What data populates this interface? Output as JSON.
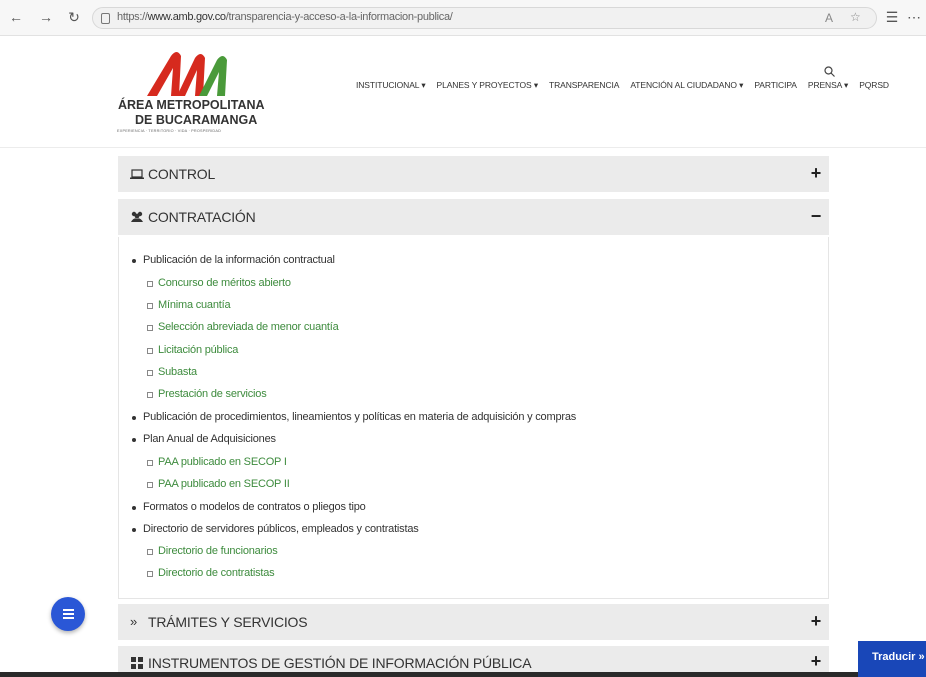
{
  "browser": {
    "url_prefix": "https://",
    "url_domain": "www.amb.gov.co",
    "url_path": "/transparencia-y-acceso-a-la-informacion-publica/"
  },
  "header": {
    "logo_title": "ÁREA METROPOLITANA",
    "logo_subtitle": "DE BUCARAMANGA",
    "logo_tagline": "EXPERIENCIA · TERRITORIO · VIDA · PROSPERIDAD",
    "nav": [
      {
        "label": "INSTITUCIONAL ▾"
      },
      {
        "label": "PLANES Y PROYECTOS ▾"
      },
      {
        "label": "TRANSPARENCIA"
      },
      {
        "label": "ATENCIÓN AL CIUDADANO ▾"
      },
      {
        "label": "PARTICIPA"
      },
      {
        "label": "PRENSA ▾"
      },
      {
        "label": "PQRSD"
      }
    ]
  },
  "accordion": {
    "control": {
      "title": "CONTROL",
      "toggle": "+"
    },
    "contratacion": {
      "title": "CONTRATACIÓN",
      "toggle": "−"
    },
    "tramites": {
      "title": "TRÁMITES Y SERVICIOS",
      "toggle": "+"
    },
    "instrumentos": {
      "title": "INSTRUMENTOS DE GESTIÓN DE INFORMACIÓN PÚBLICA",
      "toggle": "+"
    }
  },
  "contratacion_items": [
    {
      "level": 1,
      "text": "Publicación de la información contractual"
    },
    {
      "level": 2,
      "text": "Concurso de méritos abierto"
    },
    {
      "level": 2,
      "text": "Mínima cuantía"
    },
    {
      "level": 2,
      "text": "Selección abreviada de menor cuantía"
    },
    {
      "level": 2,
      "text": "Licitación pública"
    },
    {
      "level": 2,
      "text": "Subasta"
    },
    {
      "level": 2,
      "text": "Prestación de servicios"
    },
    {
      "level": 1,
      "text": "Publicación de procedimientos, lineamientos y políticas en materia de adquisición y compras"
    },
    {
      "level": 1,
      "text": "Plan Anual de Adquisiciones"
    },
    {
      "level": 2,
      "text": "PAA publicado en SECOP I"
    },
    {
      "level": 2,
      "text": "PAA publicado en SECOP II"
    },
    {
      "level": 1,
      "text": "Formatos o modelos de contratos o pliegos tipo"
    },
    {
      "level": 1,
      "text": "Directorio de servidores públicos, empleados y contratistas"
    },
    {
      "level": 2,
      "text": "Directorio de funcionarios"
    },
    {
      "level": 2,
      "text": "Directorio de contratistas"
    }
  ],
  "translate_label": "Traducir »",
  "colors": {
    "link": "#3d8b3d",
    "panel": "#ebebeb",
    "fab": "#2a57d6",
    "translate": "#1947b8",
    "logo_red": "#d62a1e",
    "logo_green": "#4a9a3a"
  }
}
